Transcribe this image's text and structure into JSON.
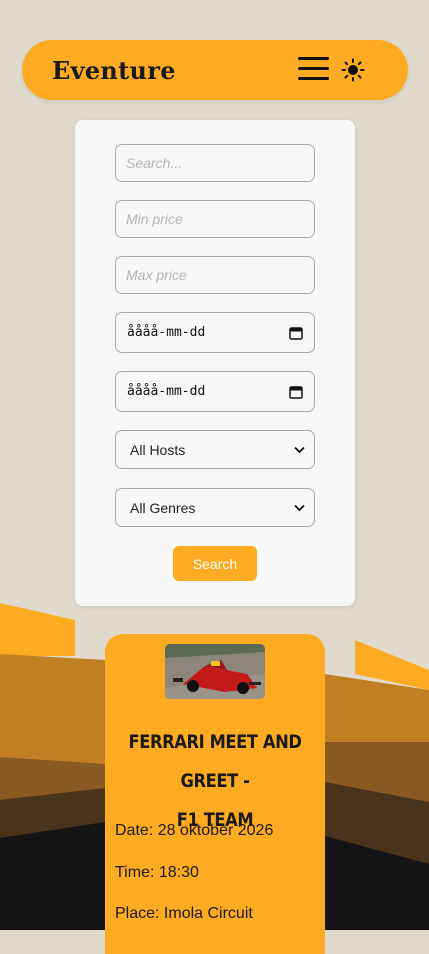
{
  "brand": "Eventure",
  "colors": {
    "accent": "#fdab22",
    "background": "#e0dacd"
  },
  "icons": {
    "menu": "hamburger-menu-icon",
    "theme": "sun-icon",
    "calendar": "calendar-icon",
    "dropdown": "chevron-down-icon"
  },
  "search": {
    "query_placeholder": "Search...",
    "min_price_placeholder": "Min price",
    "max_price_placeholder": "Max price",
    "date_from": "åååå-mm-dd",
    "date_to": "åååå-mm-dd",
    "host_selected": "All Hosts",
    "genre_selected": "All Genres",
    "button_label": "Search"
  },
  "event": {
    "title_line1": "Ferrari meet and greet -",
    "title_line2": "F1 Team",
    "date": "Date: 28 oktober 2026",
    "time": "Time: 18:30",
    "place": "Place: Imola Circuit"
  }
}
